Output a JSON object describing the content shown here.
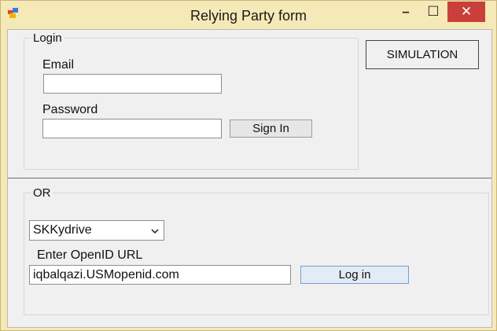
{
  "window": {
    "title": "Relying Party form",
    "minimize_glyph": "–",
    "maximize_glyph": "☐",
    "close_glyph": "✕"
  },
  "login_group": {
    "title": "Login",
    "email_label": "Email",
    "email_value": "",
    "password_label": "Password",
    "password_value": "",
    "sign_in_label": "Sign In"
  },
  "simulation_button_label": "SIMULATION",
  "openid_group": {
    "title": "OR",
    "provider_selected": "SKKydrive",
    "url_label": "Enter OpenID URL",
    "url_value": "iqbalqazi.USMopenid.com",
    "login_label": "Log in"
  },
  "colors": {
    "window_frame": "#f5e9b7",
    "client_bg": "#f0f0f0",
    "close_button": "#c9403a"
  },
  "icons": {
    "app": "app-icon",
    "dropdown": "chevron-down-icon"
  }
}
